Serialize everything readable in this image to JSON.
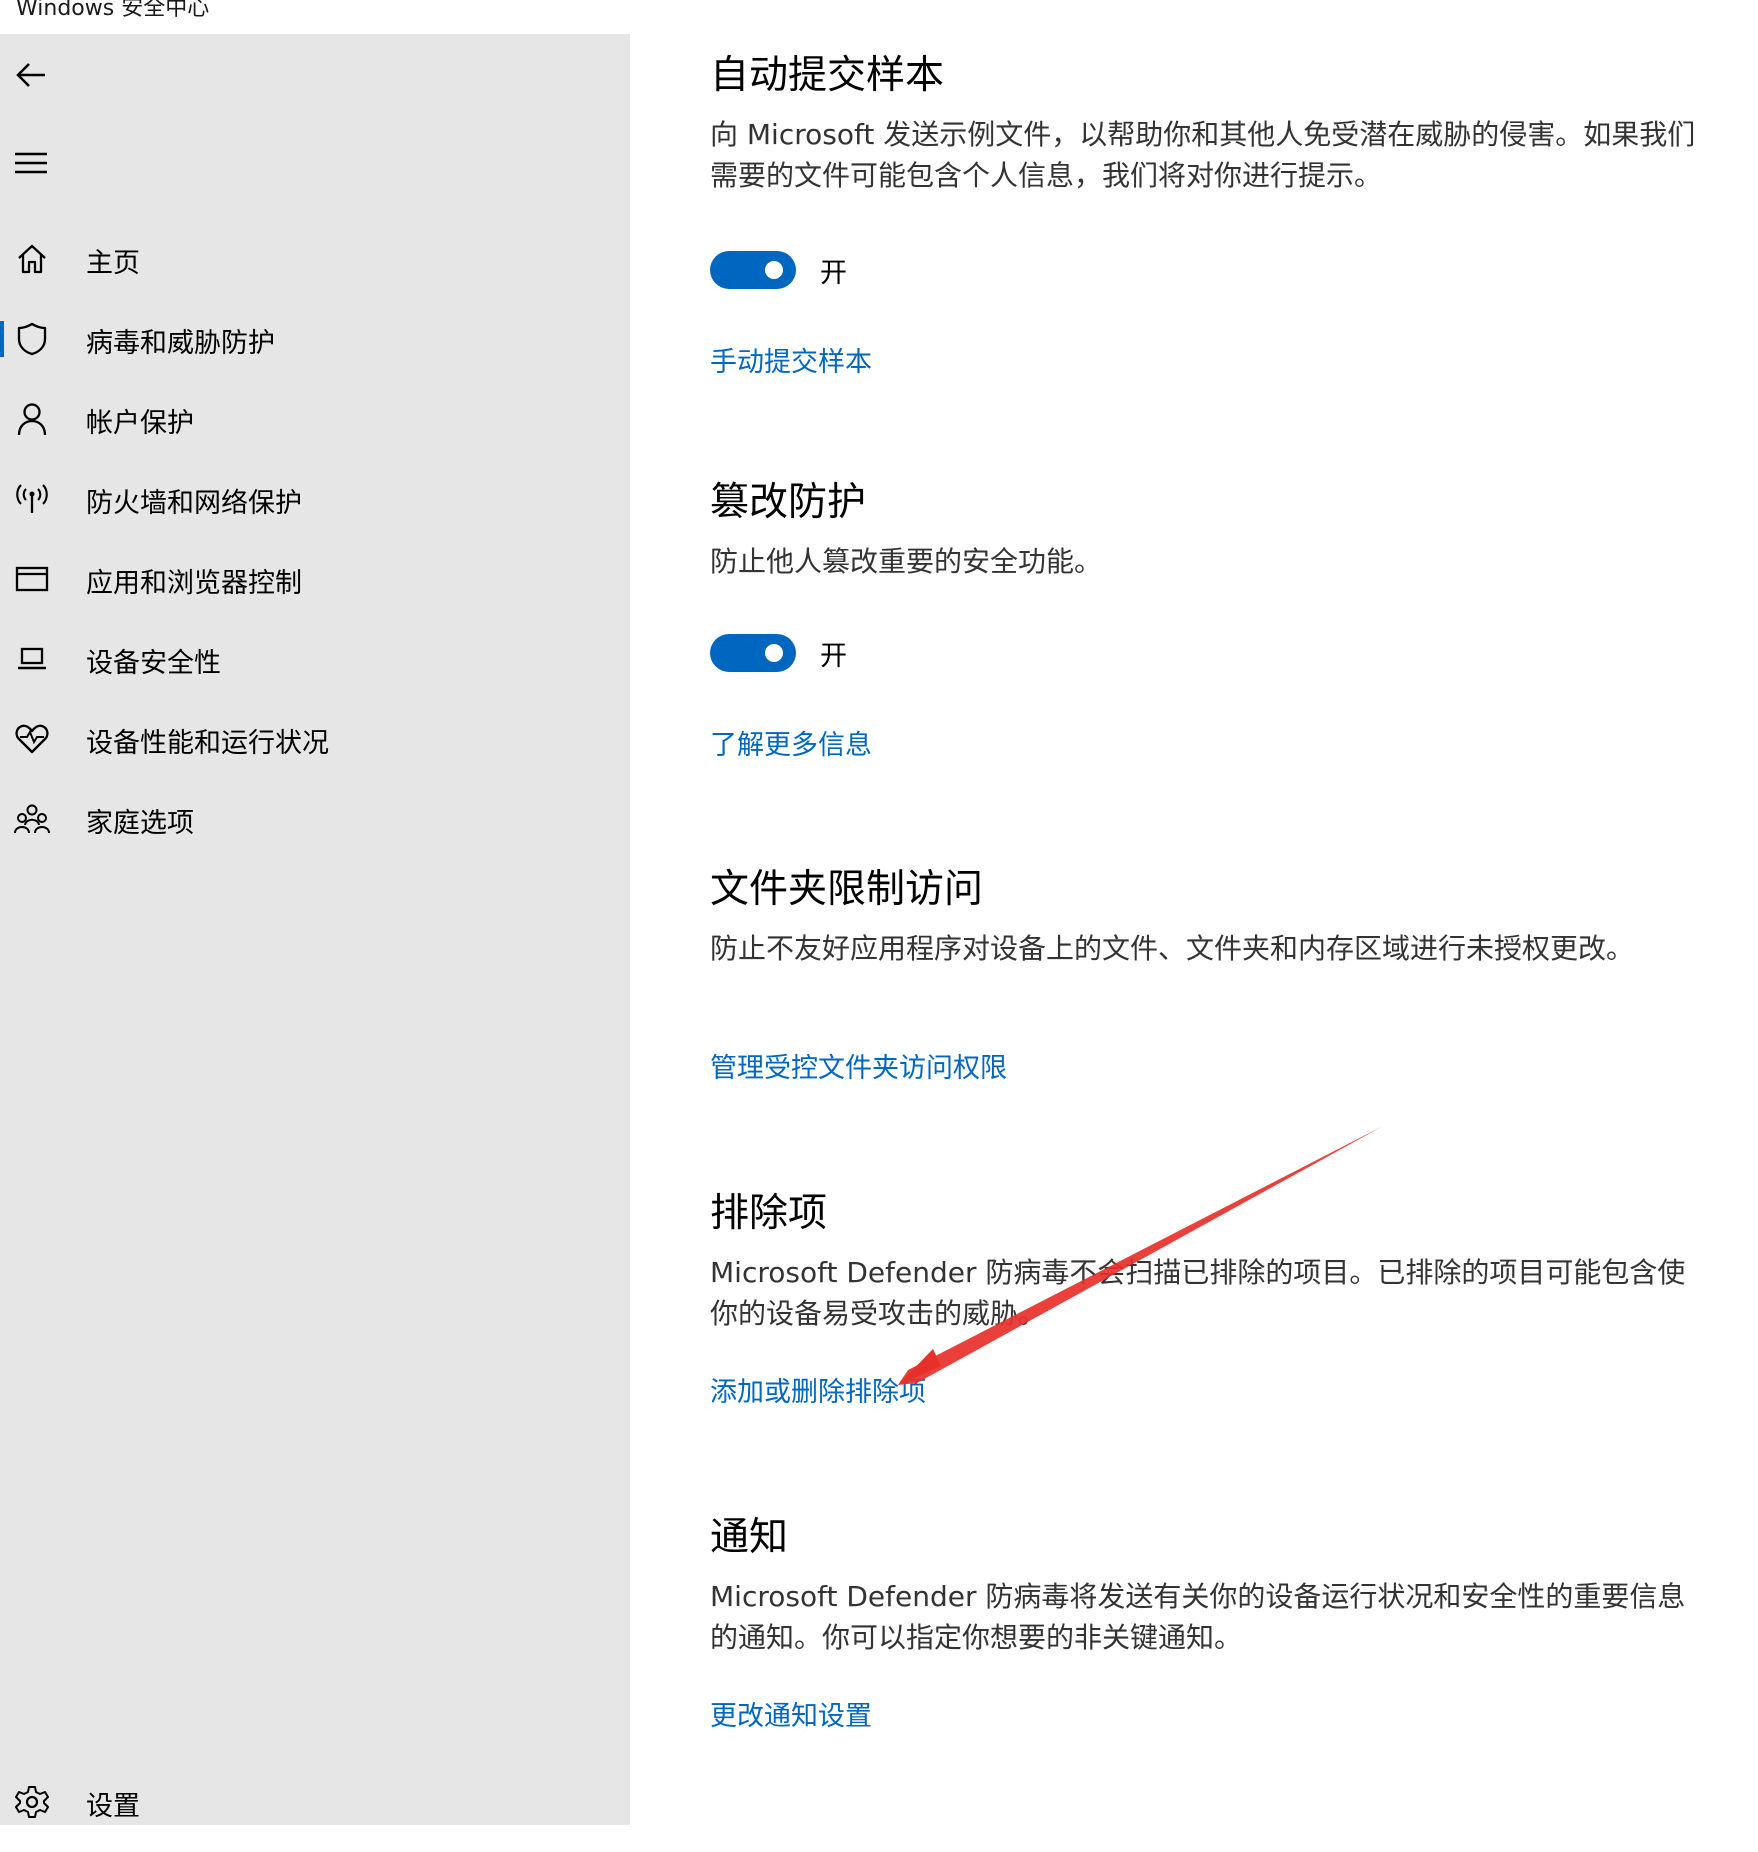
{
  "window": {
    "title": "Windows 安全中心"
  },
  "sidebar": {
    "back_icon": "back-arrow-icon",
    "menu_icon": "hamburger-menu-icon",
    "items": [
      {
        "label": "主页",
        "icon": "home-icon",
        "active": false
      },
      {
        "label": "病毒和威胁防护",
        "icon": "shield-icon",
        "active": true
      },
      {
        "label": "帐户保护",
        "icon": "person-icon",
        "active": false
      },
      {
        "label": "防火墙和网络保护",
        "icon": "wireless-signal-icon",
        "active": false
      },
      {
        "label": "应用和浏览器控制",
        "icon": "browser-window-icon",
        "active": false
      },
      {
        "label": "设备安全性",
        "icon": "laptop-icon",
        "active": false
      },
      {
        "label": "设备性能和运行状况",
        "icon": "heart-pulse-icon",
        "active": false
      },
      {
        "label": "家庭选项",
        "icon": "family-icon",
        "active": false
      }
    ],
    "settings": {
      "label": "设置",
      "icon": "gear-icon"
    }
  },
  "sections": {
    "sample_submission": {
      "title": "自动提交样本",
      "description": "向 Microsoft 发送示例文件，以帮助你和其他人免受潜在威胁的侵害。如果我们需要的文件可能包含个人信息，我们将对你进行提示。",
      "toggle_state": "开",
      "toggle_on": true,
      "link": "手动提交样本"
    },
    "tamper_protection": {
      "title": "篡改防护",
      "description": "防止他人篡改重要的安全功能。",
      "toggle_state": "开",
      "toggle_on": true,
      "link": "了解更多信息"
    },
    "controlled_folder_access": {
      "title": "文件夹限制访问",
      "description": "防止不友好应用程序对设备上的文件、文件夹和内存区域进行未授权更改。",
      "link": "管理受控文件夹访问权限"
    },
    "exclusions": {
      "title": "排除项",
      "description": "Microsoft Defender 防病毒不会扫描已排除的项目。已排除的项目可能包含使你的设备易受攻击的威胁。",
      "link": "添加或删除排除项"
    },
    "notifications": {
      "title": "通知",
      "description": "Microsoft Defender 防病毒将发送有关你的设备运行状况和安全性的重要信息的通知。你可以指定你想要的非关键通知。",
      "link": "更改通知设置"
    }
  },
  "colors": {
    "accent": "#0067c0",
    "sidebar_bg": "#e6e6e6",
    "annotation_arrow": "#e8302a"
  }
}
